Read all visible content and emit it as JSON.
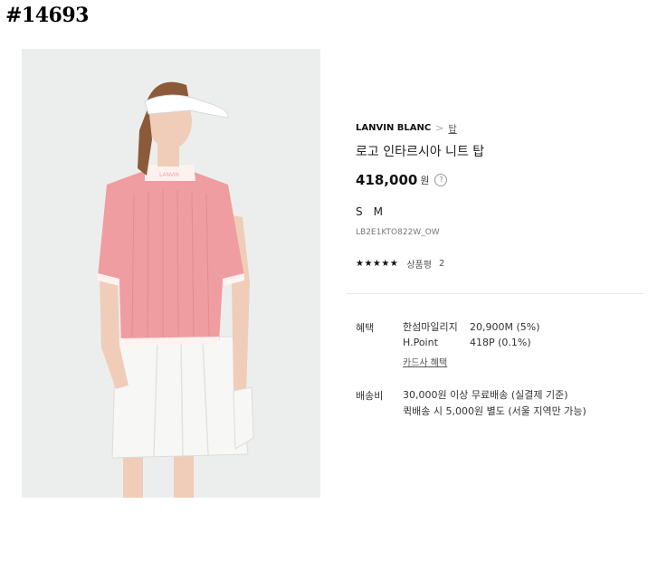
{
  "page_id": "#14693",
  "product": {
    "brand": "LANVIN BLANC",
    "breadcrumb_separator": ">",
    "category": "탑",
    "name": "로고 인타르시아 니트 탑",
    "price": "418,000",
    "currency": "원",
    "price_help_icon": "?",
    "sizes": [
      "S",
      "M"
    ],
    "sku": "LB2E1KTO822W_OW",
    "rating": {
      "stars": "★★★★★",
      "label": "상품평",
      "count": "2"
    }
  },
  "benefits": {
    "label": "혜택",
    "items": [
      {
        "name": "한섬마일리지",
        "value": "20,900M (5%)"
      },
      {
        "name": "H.Point",
        "value": "418P (0.1%)"
      }
    ],
    "card_link": "카드사 혜택"
  },
  "shipping": {
    "label": "배송비",
    "lines": [
      "30,000원 이상 무료배송 (실결제 기준)",
      "퀵배송 시 5,000원 별도 (서울 지역만 가능)"
    ]
  },
  "photo": {
    "collar_text": "LANVIN",
    "colors": {
      "background": "#eceeed",
      "knit": "#ef9da0",
      "skirt": "#f7f7f5",
      "skin": "#efcdb9",
      "hair": "#8a5a3a"
    }
  }
}
